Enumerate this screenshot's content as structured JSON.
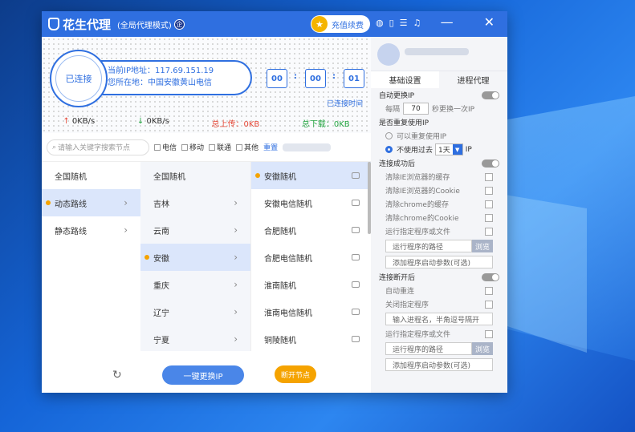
{
  "app": {
    "title": "花生代理",
    "mode": "(全局代理模式)",
    "mode_badge": "企",
    "recharge_label": "充值续费",
    "minimize": "—",
    "close": "✕"
  },
  "connection": {
    "status_label": "已连接",
    "ip_label": "当前IP地址：117.69.151.19",
    "location_label": "您所在地：中国安徽黄山电信",
    "hours": "00",
    "minutes": "00",
    "seconds": "01",
    "duration_label": "已连接时间",
    "upload_speed": "0KB/s",
    "download_speed": "0KB/s",
    "total_upload": "总上传：0KB",
    "total_download": "总下载：0KB"
  },
  "filter": {
    "search_placeholder": "请输入关键字搜索节点",
    "telecom": "电信",
    "mobile": "移动",
    "unicom": "联通",
    "other": "其他",
    "reset": "重置"
  },
  "col1": [
    "全国随机",
    "动态路线",
    "静态路线"
  ],
  "col2": [
    "全国随机",
    "吉林",
    "云南",
    "安徽",
    "重庆",
    "辽宁",
    "宁夏"
  ],
  "col3": [
    "安徽随机",
    "安徽电信随机",
    "合肥随机",
    "合肥电信随机",
    "淮南随机",
    "淮南电信随机",
    "铜陵随机"
  ],
  "bottom": {
    "refresh_icon": "↻",
    "change_ip": "一键更换IP",
    "disconnect": "断开节点"
  },
  "panel": {
    "tabs": [
      "基础设置",
      "进程代理"
    ],
    "auto_change": "自动更换IP",
    "every": "每隔",
    "interval": "70",
    "interval_suffix": "秒更换一次IP",
    "reuse_title": "是否重复使用IP",
    "reuse_yes": "可以重复使用IP",
    "reuse_no": "不使用过去",
    "days": "1天",
    "ip_suffix": "IP",
    "after_connect": "连接成功后",
    "clear_ie_cache": "清除IE浏览器的缓存",
    "clear_ie_cookie": "清除IE浏览器的Cookie",
    "clear_chrome_cache": "清除chrome的缓存",
    "clear_chrome_cookie": "清除chrome的Cookie",
    "run_program": "运行指定程序或文件",
    "program_path": "运行程序的路径",
    "browse": "浏览",
    "add_params": "添加程序启动参数(可选)",
    "after_disconnect": "连接断开后",
    "auto_reconnect": "自动重连",
    "close_program": "关闭指定程序",
    "process_name_placeholder": "输入进程名，半角逗号隔开",
    "run_program2": "运行指定程序或文件",
    "program_path2": "运行程序的路径",
    "browse2": "浏览",
    "add_params2": "添加程序启动参数(可选)"
  }
}
